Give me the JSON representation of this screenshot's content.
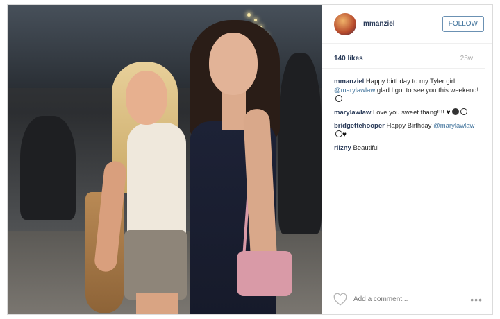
{
  "header": {
    "username": "mmanziel",
    "follow_label": "FOLLOW"
  },
  "meta": {
    "likes": "140 likes",
    "time": "25w"
  },
  "comments": [
    {
      "user": "mmanziel",
      "text_before": " Happy birthday to my Tyler girl ",
      "mention": "@marylawlaw",
      "text_after": " glad I got to see you this weekend!"
    },
    {
      "user": "marylawlaw",
      "text": " Love you sweet thang!!!!"
    },
    {
      "user": "bridgettehooper",
      "text": " Happy Birthday ",
      "mention": "@marylawlaw"
    },
    {
      "user": "riizny",
      "text": " Beautiful"
    }
  ],
  "footer": {
    "add_comment_placeholder": "Add a comment...",
    "more_label": "•••"
  },
  "icons": {
    "like": "heart-outline-icon",
    "more": "more-options-icon"
  },
  "colors": {
    "username": "#2b3c5a",
    "mention": "#3f729b",
    "muted": "#a8a8a8"
  }
}
